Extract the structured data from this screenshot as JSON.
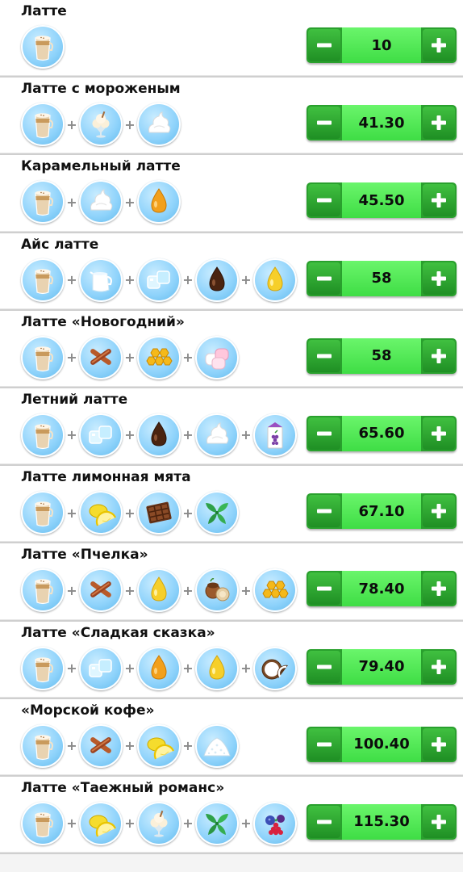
{
  "recipes": [
    {
      "name": "Латте",
      "value": "10",
      "ingredients": [
        "latte-icon"
      ]
    },
    {
      "name": "Латте с мороженым",
      "value": "41.30",
      "ingredients": [
        "latte-icon",
        "ice-cream-icon",
        "whipped-cream-icon"
      ]
    },
    {
      "name": "Карамельный латте",
      "value": "45.50",
      "ingredients": [
        "latte-icon",
        "whipped-cream-icon",
        "caramel-syrup-icon"
      ]
    },
    {
      "name": "Айс латте",
      "value": "58",
      "ingredients": [
        "latte-icon",
        "milk-jug-icon",
        "ice-cubes-icon",
        "chocolate-syrup-icon",
        "honey-drop-icon"
      ]
    },
    {
      "name": "Латте «Новогодний»",
      "value": "58",
      "ingredients": [
        "latte-icon",
        "cinnamon-icon",
        "honeycomb-icon",
        "marshmallow-icon"
      ]
    },
    {
      "name": "Летний латте",
      "value": "65.60",
      "ingredients": [
        "latte-icon",
        "ice-cubes-icon",
        "chocolate-syrup-icon",
        "whipped-cream-icon",
        "juice-box-icon"
      ]
    },
    {
      "name": "Латте лимонная мята",
      "value": "67.10",
      "ingredients": [
        "latte-icon",
        "lemon-icon",
        "chocolate-bar-icon",
        "mint-icon"
      ]
    },
    {
      "name": "Латте «Пчелка»",
      "value": "78.40",
      "ingredients": [
        "latte-icon",
        "cinnamon-icon",
        "honey-drop-icon",
        "hazelnut-icon",
        "honeycomb-icon"
      ]
    },
    {
      "name": "Латте «Сладкая сказка»",
      "value": "79.40",
      "ingredients": [
        "latte-icon",
        "ice-cubes-icon",
        "caramel-syrup-icon",
        "honey-drop-icon",
        "coconut-icon"
      ]
    },
    {
      "name": "«Морской кофе»",
      "value": "100.40",
      "ingredients": [
        "latte-icon",
        "cinnamon-icon",
        "lemon-icon",
        "sea-salt-icon"
      ]
    },
    {
      "name": "Латте «Таежный романс»",
      "value": "115.30",
      "ingredients": [
        "latte-icon",
        "lemon-icon",
        "ice-cream-icon",
        "mint-icon",
        "berries-icon"
      ]
    }
  ],
  "colors": {
    "stepper_dark": "#29a02d",
    "stepper_light": "#4be650",
    "icon_bg": "#8fd3fb"
  }
}
